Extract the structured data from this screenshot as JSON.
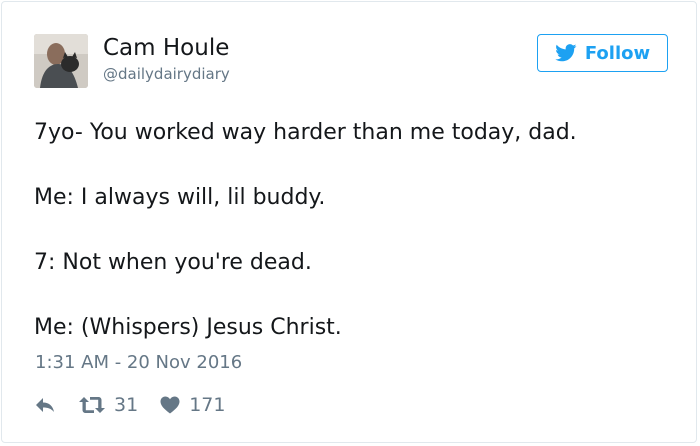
{
  "user": {
    "name": "Cam Houle",
    "handle": "@dailydairydiary"
  },
  "follow_button": {
    "label": "Follow",
    "icon": "twitter-bird-icon",
    "color": "#1da1f2"
  },
  "tweet": {
    "lines": [
      "7yo- You worked way harder than me today, dad.",
      "Me: I always will, lil buddy.",
      "7: Not when you're dead.",
      "Me: (Whispers) Jesus Christ."
    ],
    "timestamp": "1:31 AM - 20 Nov 2016"
  },
  "actions": {
    "reply_icon": "reply-icon",
    "retweet_icon": "retweet-icon",
    "retweet_count": "31",
    "like_icon": "heart-icon",
    "like_count": "171"
  }
}
